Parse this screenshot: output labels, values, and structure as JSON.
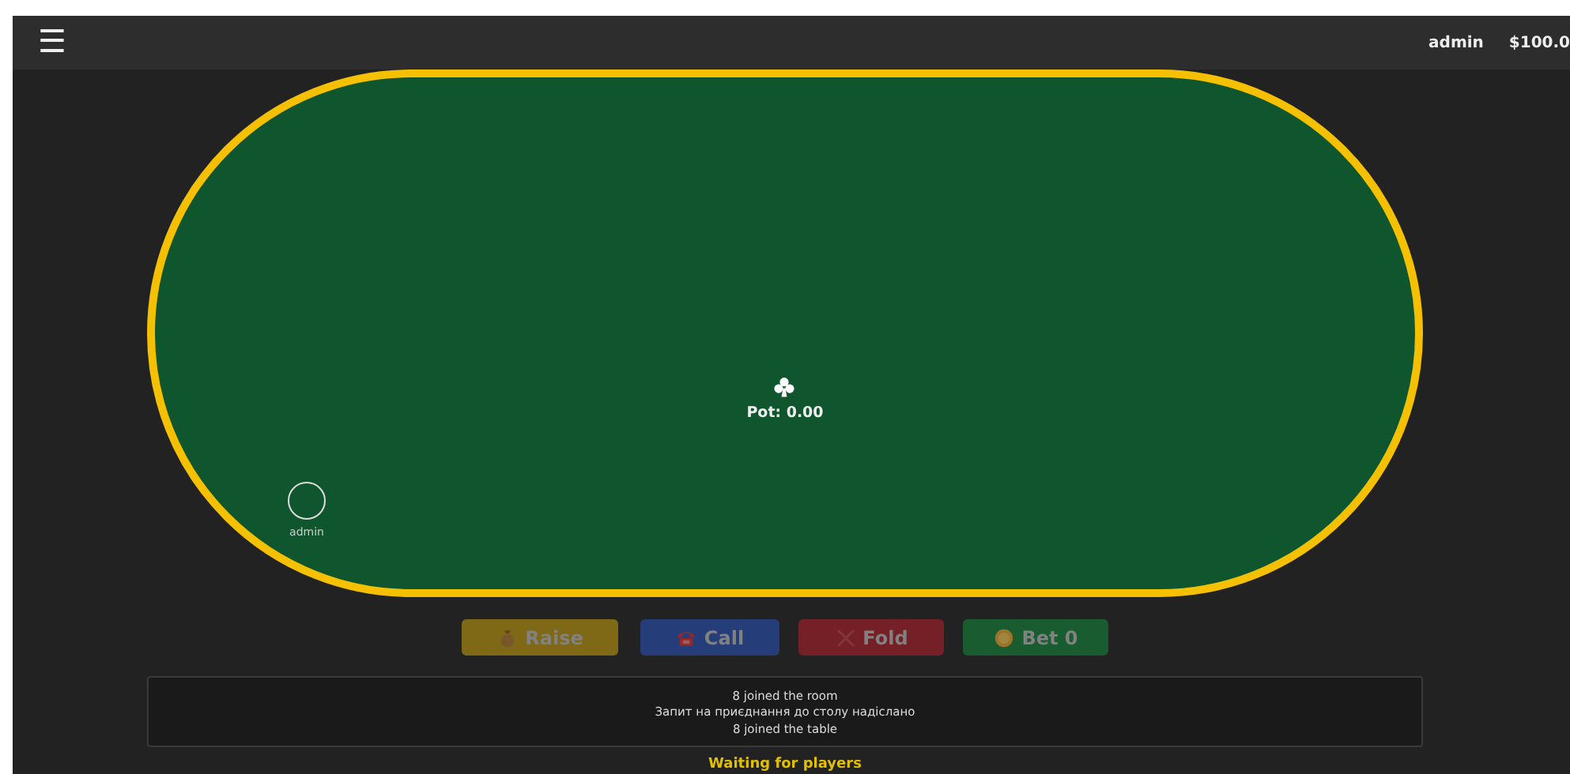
{
  "header": {
    "menu_icon": "☰",
    "user": "admin",
    "balance": "$100.0"
  },
  "table": {
    "pot": "Pot: 0.00",
    "seats": [
      {
        "name": "admin"
      }
    ]
  },
  "actions": [
    {
      "kind": "raise",
      "label": "Raise",
      "disabled": true
    },
    {
      "kind": "call",
      "label": "Call",
      "disabled": true
    },
    {
      "kind": "fold",
      "label": "Fold",
      "disabled": true
    },
    {
      "kind": "bet",
      "label": "Bet 0",
      "disabled": true
    }
  ],
  "log": [
    "8 joined the room",
    "Запит на приєднання до столу надіслано",
    "8 joined the table"
  ],
  "status": "Waiting for players"
}
